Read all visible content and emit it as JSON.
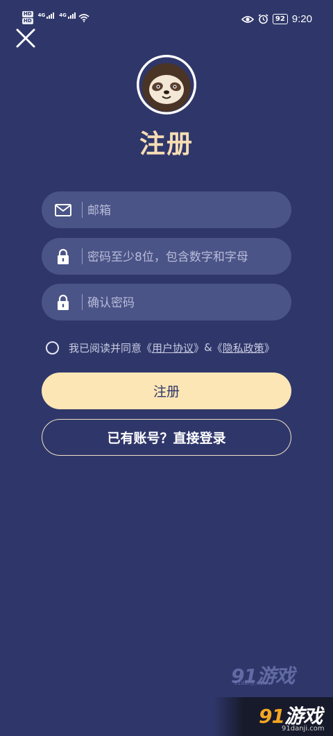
{
  "status_bar": {
    "hd1": "HD",
    "hd2": "HD",
    "signal1_label": "4G",
    "signal2_label": "4G",
    "battery": "92",
    "time": "9:20"
  },
  "title": "注册",
  "form": {
    "email_placeholder": "邮箱",
    "password_placeholder": "密码至少8位，包含数字和字母",
    "confirm_placeholder": "确认密码"
  },
  "agreement": {
    "prefix": "我已阅读并同意",
    "open1": "《",
    "user_agreement": "用户协议",
    "close1": "》",
    "amp": "&",
    "open2": "《",
    "privacy_policy": "隐私政策",
    "close2": "》"
  },
  "buttons": {
    "register": "注册",
    "login": "已有账号？直接登录"
  },
  "watermark": {
    "logo_num": "91",
    "logo_text": "游戏",
    "url": "91danji.com"
  },
  "colors": {
    "background": "#2f376a",
    "accent": "#fde6b5",
    "title": "#f6ddb4",
    "field": "#4b5487"
  }
}
